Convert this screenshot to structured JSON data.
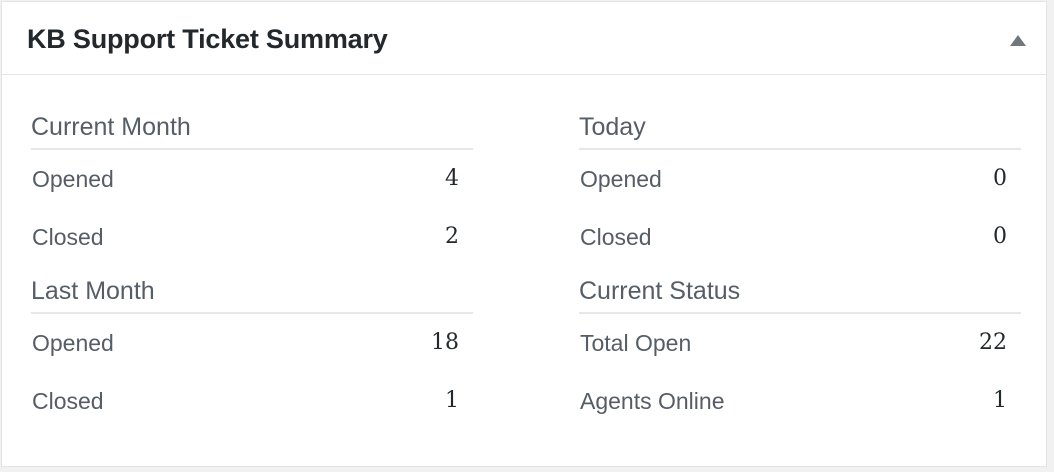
{
  "widget": {
    "title": "KB Support Ticket Summary"
  },
  "sections": {
    "current_month": {
      "title": "Current Month",
      "rows": [
        {
          "label": "Opened",
          "value": "4"
        },
        {
          "label": "Closed",
          "value": "2"
        }
      ]
    },
    "last_month": {
      "title": "Last Month",
      "rows": [
        {
          "label": "Opened",
          "value": "18"
        },
        {
          "label": "Closed",
          "value": "1"
        }
      ]
    },
    "today": {
      "title": "Today",
      "rows": [
        {
          "label": "Opened",
          "value": "0"
        },
        {
          "label": "Closed",
          "value": "0"
        }
      ]
    },
    "current_status": {
      "title": "Current Status",
      "rows": [
        {
          "label": "Total Open",
          "value": "22"
        },
        {
          "label": "Agents Online",
          "value": "1"
        }
      ]
    }
  },
  "icons": {
    "toggle": "triangle-up-icon"
  }
}
